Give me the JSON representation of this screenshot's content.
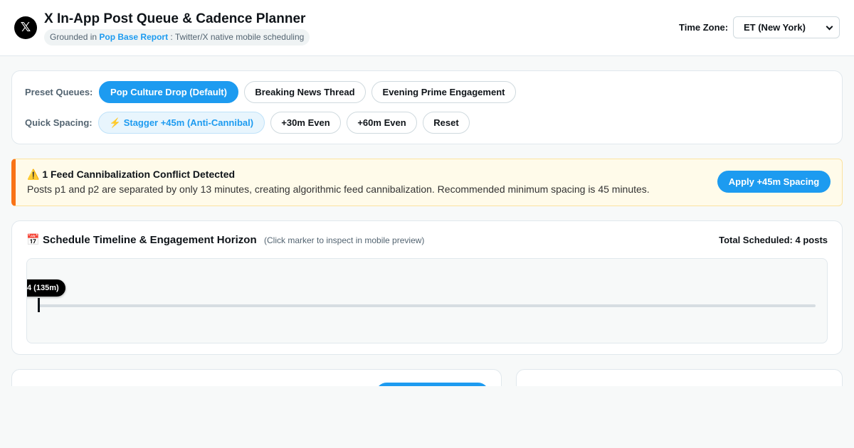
{
  "header": {
    "logo_glyph": "𝕏",
    "title": "X In-App Post Queue & Cadence Planner",
    "subtitle_prefix": "Grounded in",
    "subtitle_link": "Pop Base Report",
    "subtitle_suffix": ": Twitter/X native mobile scheduling",
    "timezone_label": "Time Zone:",
    "timezone_value": "ET (New York)"
  },
  "presets": {
    "queues_label": "Preset Queues:",
    "queues": [
      {
        "label": "Pop Culture Drop (Default)",
        "active": true
      },
      {
        "label": "Breaking News Thread",
        "active": false
      },
      {
        "label": "Evening Prime Engagement",
        "active": false
      }
    ],
    "spacing_label": "Quick Spacing:",
    "spacing": [
      {
        "label": "⚡ Stagger +45m (Anti-Cannibal)"
      },
      {
        "label": "+30m Even"
      },
      {
        "label": "+60m Even"
      },
      {
        "label": "Reset"
      }
    ]
  },
  "alert": {
    "icon": "⚠️",
    "title": "1 Feed Cannibalization Conflict Detected",
    "message": "Posts p1 and p2 are separated by only 13 minutes, creating algorithmic feed cannibalization. Recommended minimum spacing is 45 minutes.",
    "button_label": "Apply +45m Spacing"
  },
  "timeline": {
    "icon": "📅",
    "title": "Schedule Timeline & Engagement Horizon",
    "hint": "(Click marker to inspect in mobile preview)",
    "total_label": "Total Scheduled: 4 posts",
    "marker_label": "4 (135m)"
  },
  "colors": {
    "accent": "#1d9bf0",
    "warning_border": "#f97316",
    "warning_bg": "#fffbea"
  }
}
